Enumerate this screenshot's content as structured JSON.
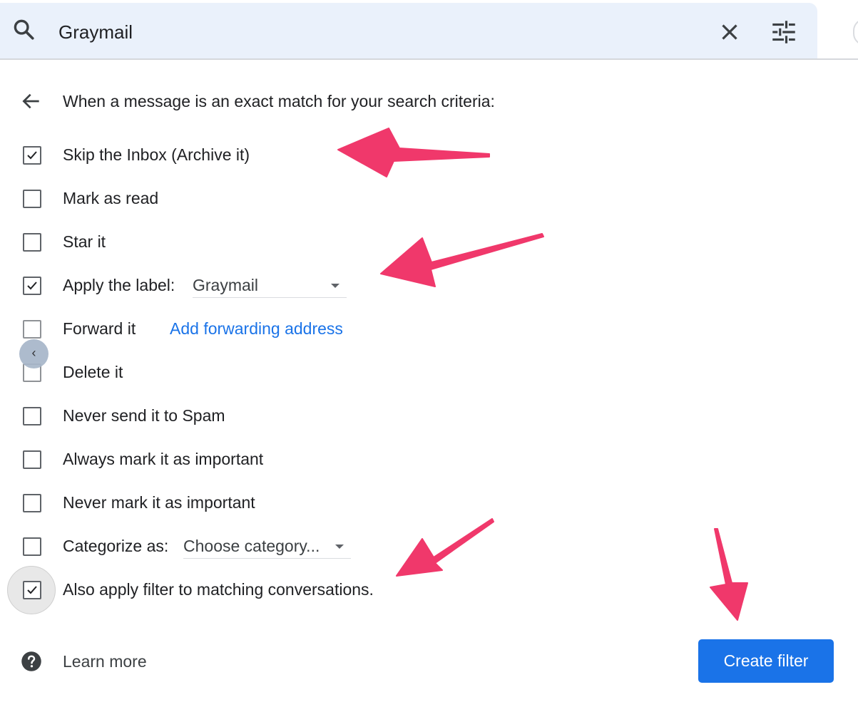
{
  "search": {
    "query": "Graymail"
  },
  "header": {
    "criteria_text": "When a message is an exact match for your search criteria:"
  },
  "options": [
    {
      "label": "Skip the Inbox (Archive it)",
      "checked": true
    },
    {
      "label": "Mark as read",
      "checked": false
    },
    {
      "label": "Star it",
      "checked": false
    },
    {
      "label": "Apply the label:",
      "checked": true,
      "select_value": "Graymail"
    },
    {
      "label": "Forward it",
      "checked": false,
      "link": "Add forwarding address"
    },
    {
      "label": "Delete it",
      "checked": false
    },
    {
      "label": "Never send it to Spam",
      "checked": false
    },
    {
      "label": "Always mark it as important",
      "checked": false
    },
    {
      "label": "Never mark it as important",
      "checked": false
    },
    {
      "label": "Categorize as:",
      "checked": false,
      "select_value": "Choose category..."
    },
    {
      "label": "Also apply filter to matching conversations.",
      "checked": true
    }
  ],
  "footer": {
    "learn_more": "Learn more",
    "create_filter": "Create filter"
  },
  "colors": {
    "search_bg": "#eaf1fb",
    "accent": "#1a73e8",
    "annotation_arrow": "#f0386b"
  },
  "icons": [
    "search-icon",
    "close-icon",
    "tune-icon",
    "arrow-back-icon",
    "checkmark-icon",
    "caret-down-icon",
    "chevron-left-icon",
    "help-icon"
  ]
}
